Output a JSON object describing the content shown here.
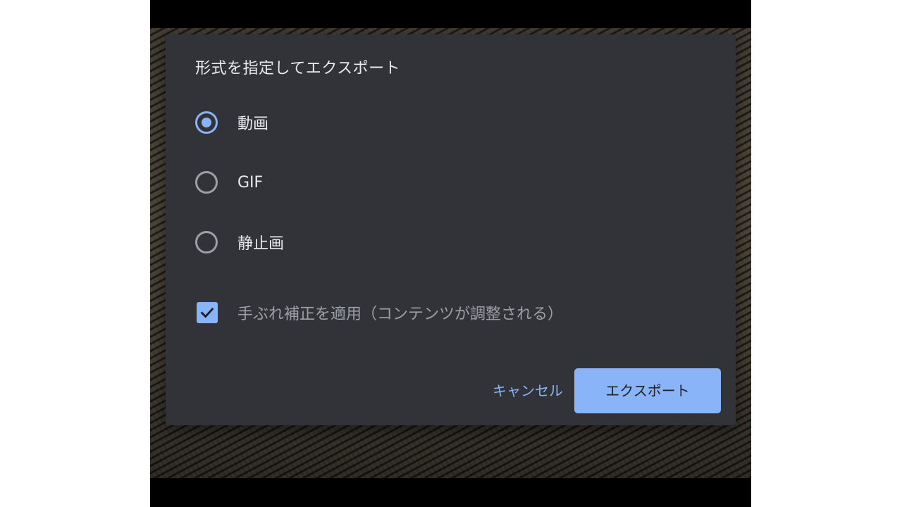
{
  "dialog": {
    "title": "形式を指定してエクスポート",
    "options": [
      {
        "label": "動画",
        "selected": true
      },
      {
        "label": "GIF",
        "selected": false
      },
      {
        "label": "静止画",
        "selected": false
      }
    ],
    "stabilize": {
      "label": "手ぶれ補正を適用（コンテンツが調整される）",
      "checked": true
    },
    "cancel_label": "キャンセル",
    "export_label": "エクスポート"
  },
  "colors": {
    "accent": "#8ab4f8",
    "dialog_bg": "#323339",
    "text_primary": "#e8eaed",
    "text_secondary": "#9aa0a6"
  },
  "icons": {
    "checkbox": "check-icon"
  }
}
